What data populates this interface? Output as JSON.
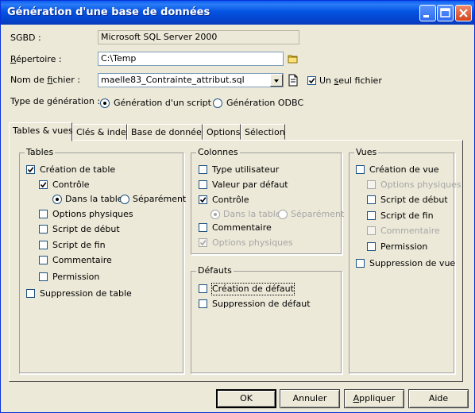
{
  "window": {
    "title": "Génération d'une base de données"
  },
  "form": {
    "sgbd_label": "SGBD :",
    "sgbd_value": "Microsoft SQL Server 2000",
    "repertoire_label": "Répertoire :",
    "repertoire_value": "C:\\Temp",
    "fichier_label": "Nom de fichier :",
    "fichier_value": "maelle83_Contrainte_attribut.sql",
    "seul_fichier_label": "Un seul fichier",
    "type_label": "Type de génération :",
    "type_script_label": "Génération d'un script",
    "type_odbc_label": "Génération ODBC"
  },
  "tabs": [
    {
      "label": "Tables & vues"
    },
    {
      "label": "Clés & index"
    },
    {
      "label": "Base de données"
    },
    {
      "label": "Options"
    },
    {
      "label": "Sélection"
    }
  ],
  "tables": {
    "title": "Tables",
    "creation": "Création de table",
    "controle": "Contrôle",
    "dans_table": "Dans la table",
    "separement": "Séparément",
    "options_physiques": "Options physiques",
    "script_debut": "Script de début",
    "script_fin": "Script de fin",
    "commentaire": "Commentaire",
    "permission": "Permission",
    "suppression": "Suppression de table"
  },
  "colonnes": {
    "title": "Colonnes",
    "type_utilisateur": "Type utilisateur",
    "valeur_defaut": "Valeur par défaut",
    "controle": "Contrôle",
    "dans_table": "Dans la table",
    "separement": "Séparément",
    "commentaire": "Commentaire",
    "options_physiques": "Options physiques"
  },
  "defauts": {
    "title": "Défauts",
    "creation": "Création de défaut",
    "suppression": "Suppression de défaut"
  },
  "vues": {
    "title": "Vues",
    "creation": "Création de vue",
    "options_physiques": "Options physiques",
    "script_debut": "Script de début",
    "script_fin": "Script de fin",
    "commentaire": "Commentaire",
    "permission": "Permission",
    "suppression": "Suppression de vue"
  },
  "buttons": {
    "ok": "OK",
    "annuler": "Annuler",
    "appliquer": "Appliquer",
    "aide": "Aide"
  }
}
